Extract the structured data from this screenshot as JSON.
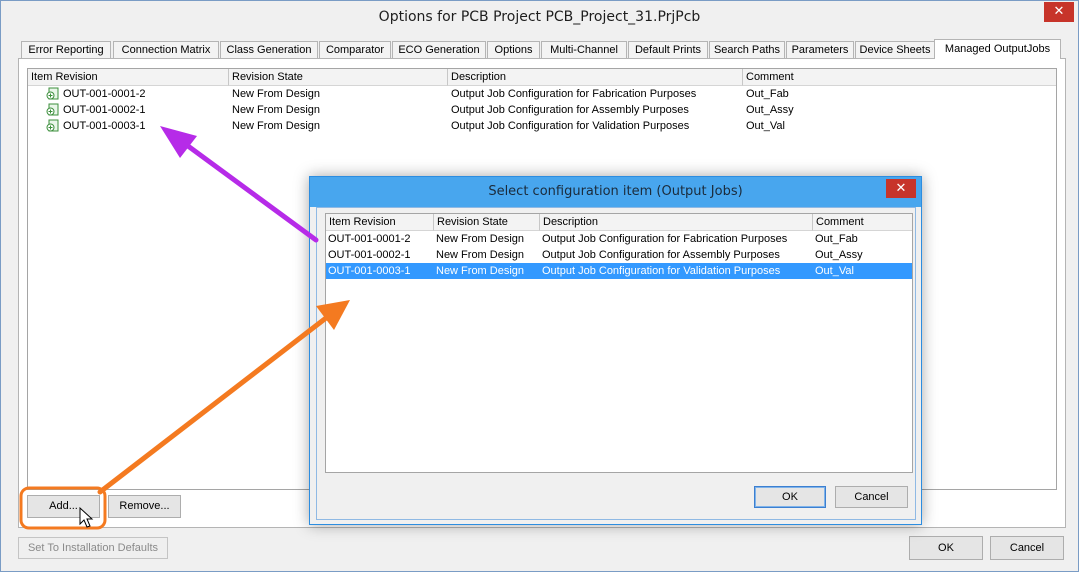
{
  "window": {
    "title": "Options for PCB Project PCB_Project_31.PrjPcb",
    "close_glyph": "✕"
  },
  "tabs": [
    {
      "label": "Error Reporting"
    },
    {
      "label": "Connection Matrix"
    },
    {
      "label": "Class Generation"
    },
    {
      "label": "Comparator"
    },
    {
      "label": "ECO Generation"
    },
    {
      "label": "Options"
    },
    {
      "label": "Multi-Channel"
    },
    {
      "label": "Default Prints"
    },
    {
      "label": "Search Paths"
    },
    {
      "label": "Parameters"
    },
    {
      "label": "Device Sheets"
    },
    {
      "label": "Managed OutputJobs",
      "active": true
    }
  ],
  "main_list": {
    "columns": [
      "Item Revision",
      "Revision State",
      "Description",
      "Comment"
    ],
    "rows": [
      {
        "revision": "OUT-001-0001-2",
        "state": "New From Design",
        "description": "Output Job Configuration for Fabrication Purposes",
        "comment": "Out_Fab",
        "icon": "output-job-icon"
      },
      {
        "revision": "OUT-001-0002-1",
        "state": "New From Design",
        "description": "Output Job Configuration for Assembly Purposes",
        "comment": "Out_Assy",
        "icon": "output-job-icon"
      },
      {
        "revision": "OUT-001-0003-1",
        "state": "New From Design",
        "description": "Output Job Configuration for Validation Purposes",
        "comment": "Out_Val",
        "icon": "output-job-icon"
      }
    ]
  },
  "buttons": {
    "add": "Add...",
    "remove": "Remove...",
    "set_defaults": "Set To Installation Defaults",
    "ok": "OK",
    "cancel": "Cancel"
  },
  "dialog": {
    "title": "Select configuration item (Output Jobs)",
    "close_glyph": "✕",
    "columns": [
      "Item Revision",
      "Revision State",
      "Description",
      "Comment"
    ],
    "rows": [
      {
        "revision": "OUT-001-0001-2",
        "state": "New From Design",
        "description": "Output Job Configuration for Fabrication Purposes",
        "comment": "Out_Fab",
        "selected": false
      },
      {
        "revision": "OUT-001-0002-1",
        "state": "New From Design",
        "description": "Output Job Configuration for Assembly Purposes",
        "comment": "Out_Assy",
        "selected": false
      },
      {
        "revision": "OUT-001-0003-1",
        "state": "New From Design",
        "description": "Output Job Configuration for Validation Purposes",
        "comment": "Out_Val",
        "selected": true
      }
    ],
    "ok": "OK",
    "cancel": "Cancel"
  },
  "annotations": {
    "purple_color": "#b62be8",
    "orange_color": "#f47a20",
    "selection_color": "#3399ff"
  }
}
